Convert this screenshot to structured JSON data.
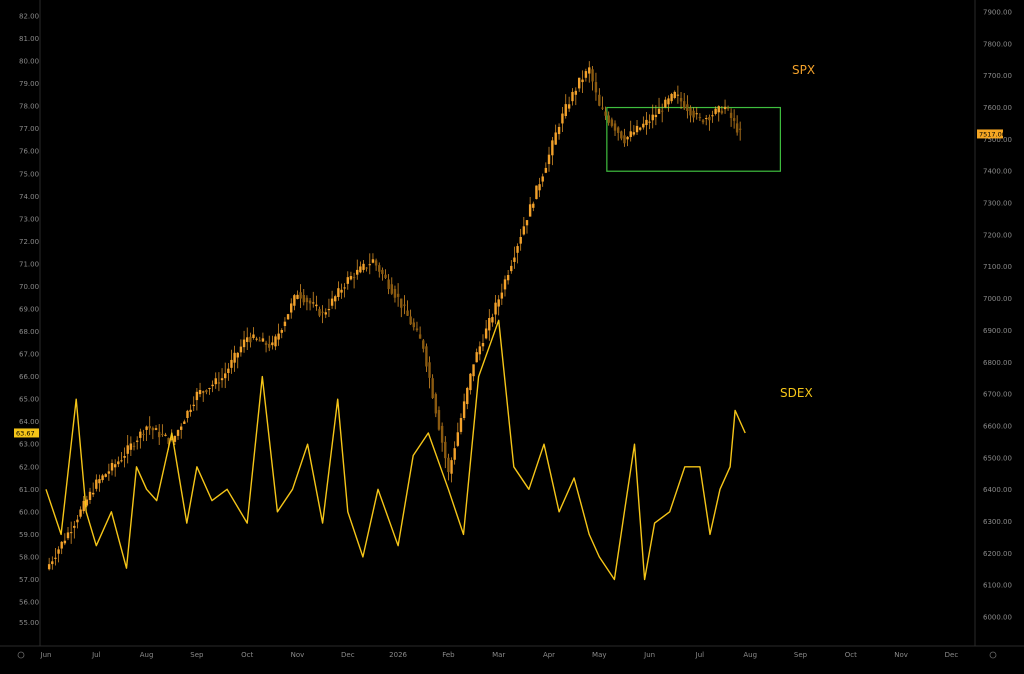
{
  "chart_data": {
    "type": "line",
    "categories": [
      "Jun",
      "Jul",
      "Aug",
      "Sep",
      "Oct",
      "Nov",
      "Dec",
      "2026",
      "Feb",
      "Mar",
      "Apr",
      "May",
      "Jun",
      "Jul",
      "Aug",
      "Sep",
      "Oct",
      "Nov",
      "Dec"
    ],
    "left_axis": {
      "ticks": [
        "57.00",
        "58.00",
        "59.00",
        "60.00",
        "61.00",
        "62.00",
        "63.00",
        "64.00",
        "65.00",
        "66.00",
        "67.00",
        "68.00",
        "69.00",
        "70.00",
        "71.00",
        "72.00",
        "73.00",
        "74.00",
        "75.00",
        "76.00",
        "77.00",
        "78.00",
        "79.00",
        "80.00",
        "81.00",
        "82.00"
      ],
      "ylim": [
        56,
        82
      ],
      "lowest_tick": "56.00",
      "extra_ticks": [
        "55.00"
      ]
    },
    "right_axis": {
      "ticks": [
        "6000.00",
        "6100.00",
        "6200.00",
        "6300.00",
        "6400.00",
        "6500.00",
        "6600.00",
        "6700.00",
        "6800.00",
        "6900.00",
        "7000.00",
        "7100.00",
        "7200.00",
        "7300.00",
        "7400.00",
        "7500.00",
        "7600.00",
        "7700.00",
        "7800.00",
        "7900.00"
      ],
      "ylim": [
        6000,
        7900
      ]
    },
    "grid": false,
    "series": [
      {
        "name": "SPX",
        "axis": "right",
        "color": "#f2a12b",
        "style": "candlestick",
        "x": [
          0,
          0.5,
          1,
          1.5,
          2,
          2.5,
          3,
          3.5,
          4,
          4.5,
          5,
          5.5,
          6,
          6.5,
          7,
          7.5,
          8,
          8.5,
          9,
          9.5,
          10,
          10.2,
          10.4,
          10.6,
          10.8,
          11,
          11.5,
          12,
          12.5,
          13,
          13.5,
          13.8
        ],
        "values": [
          6150,
          6280,
          6420,
          6500,
          6600,
          6550,
          6700,
          6750,
          6880,
          6850,
          7020,
          6950,
          7060,
          7120,
          7000,
          6850,
          6450,
          6800,
          7000,
          7230,
          7450,
          7550,
          7620,
          7680,
          7720,
          7600,
          7500,
          7560,
          7640,
          7560,
          7600,
          7517
        ],
        "last_value_label": "7517.00"
      },
      {
        "name": "SDEX",
        "axis": "left",
        "color": "#f5c518",
        "style": "line",
        "x": [
          0,
          0.3,
          0.6,
          0.8,
          1,
          1.3,
          1.6,
          1.8,
          2,
          2.2,
          2.5,
          2.8,
          3,
          3.3,
          3.6,
          4,
          4.3,
          4.6,
          4.9,
          5.2,
          5.5,
          5.8,
          6,
          6.3,
          6.6,
          7,
          7.3,
          7.6,
          8,
          8.3,
          8.6,
          9,
          9.3,
          9.6,
          9.9,
          10.2,
          10.5,
          10.8,
          11,
          11.3,
          11.5,
          11.7,
          11.9,
          12.1,
          12.4,
          12.7,
          13,
          13.2,
          13.4,
          13.6,
          13.7,
          13.9
        ],
        "values": [
          61,
          59,
          65,
          60,
          58.5,
          60,
          57.5,
          62,
          61,
          60.5,
          63.5,
          59.5,
          62,
          60.5,
          61,
          59.5,
          66,
          60,
          61,
          63,
          59.5,
          65,
          60,
          58,
          61,
          58.5,
          62.5,
          63.5,
          61,
          59,
          66,
          68.5,
          62,
          61,
          63,
          60,
          61.5,
          59,
          58,
          57,
          60,
          63,
          57,
          59.5,
          60,
          62,
          62,
          59,
          61,
          62,
          64.5,
          63.5
        ],
        "last_value_label": "63.67"
      }
    ],
    "annotations": [
      {
        "type": "box",
        "color": "#3fbf3f",
        "x_range": [
          11.15,
          14.6
        ],
        "y_range_right_axis": [
          7400,
          7600
        ]
      }
    ],
    "legend": "none"
  },
  "colors": {
    "background": "#000000",
    "axis_text": "#8a8a8a",
    "spx": "#f2a12b",
    "sdex": "#f5c518",
    "box": "#3fbf3f",
    "badge_spx": "#f5a623",
    "badge_sdex": "#f5c518"
  },
  "axis_icons": [
    "settings-icon",
    "zoom-icon"
  ]
}
